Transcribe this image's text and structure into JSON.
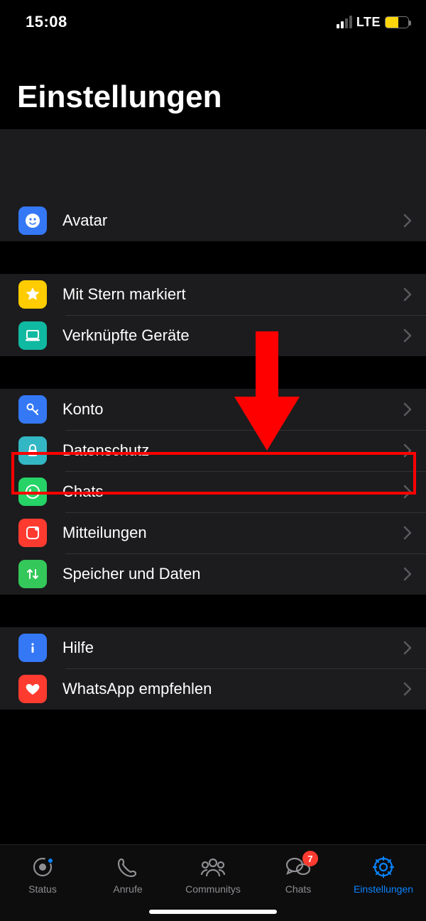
{
  "status": {
    "time": "15:08",
    "network": "LTE"
  },
  "title": "Einstellungen",
  "groups": [
    {
      "rows": [
        {
          "id": "avatar",
          "label": "Avatar"
        }
      ]
    },
    {
      "rows": [
        {
          "id": "starred",
          "label": "Mit Stern markiert"
        },
        {
          "id": "linked",
          "label": "Verknüpfte Geräte"
        }
      ]
    },
    {
      "rows": [
        {
          "id": "account",
          "label": "Konto"
        },
        {
          "id": "privacy",
          "label": "Datenschutz"
        },
        {
          "id": "chats",
          "label": "Chats"
        },
        {
          "id": "notif",
          "label": "Mitteilungen"
        },
        {
          "id": "storage",
          "label": "Speicher und Daten"
        }
      ]
    },
    {
      "rows": [
        {
          "id": "help",
          "label": "Hilfe"
        },
        {
          "id": "share",
          "label": "WhatsApp empfehlen"
        }
      ]
    }
  ],
  "tabs": {
    "status": "Status",
    "calls": "Anrufe",
    "community": "Communitys",
    "chats": "Chats",
    "settings": "Einstellungen",
    "chats_badge": "7"
  },
  "annotation": {
    "highlighted_row": "privacy"
  }
}
